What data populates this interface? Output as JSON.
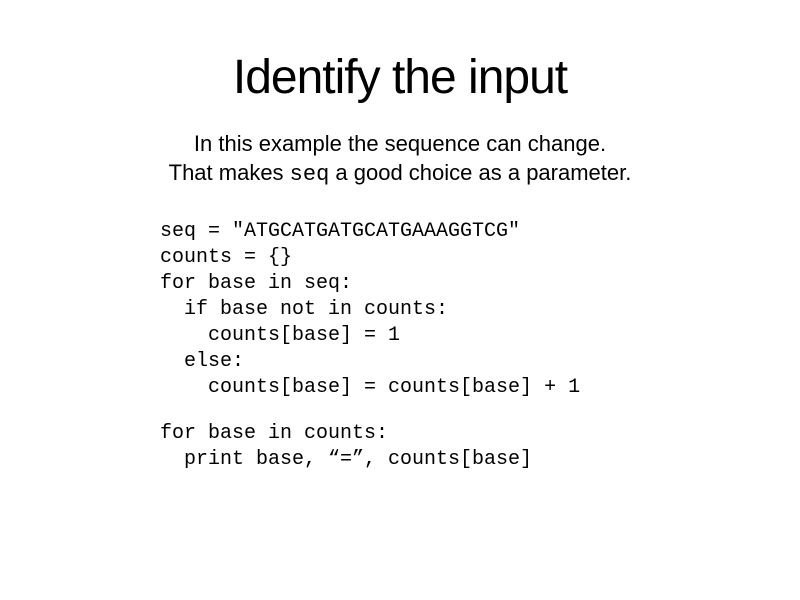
{
  "title": "Identify the input",
  "description": {
    "line1_prefix": "In this example the sequence can change.",
    "line2_prefix": "That makes ",
    "line2_code": "seq",
    "line2_suffix": " a good choice as a parameter."
  },
  "code": {
    "block1": "seq = \"ATGCATGATGCATGAAAGGTCG\"\ncounts = {}\nfor base in seq:\n  if base not in counts:\n    counts[base] = 1\n  else:\n    counts[base] = counts[base] + 1",
    "block2": "for base in counts:\n  print base, “=”, counts[base]"
  }
}
